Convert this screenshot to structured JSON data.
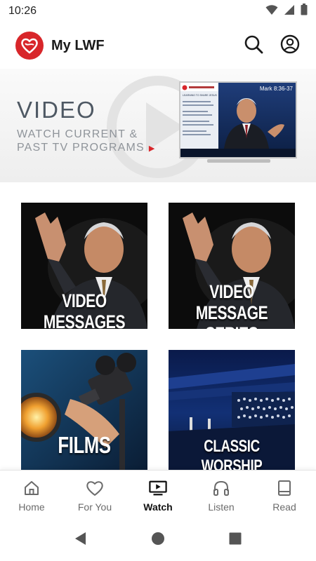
{
  "status_bar": {
    "time": "10:26"
  },
  "header": {
    "title": "My LWF",
    "logo_icon": "heart-logo-icon",
    "search_icon": "search-icon",
    "account_icon": "account-icon"
  },
  "banner": {
    "title": "VIDEO",
    "subtitle_line1": "WATCH CURRENT &",
    "subtitle_line2": "PAST TV PROGRAMS",
    "arrow": "▶",
    "tv_caption": "Mark 8:36-37",
    "tv_heading": "LEARNING TO SHARE JESUS"
  },
  "tiles": [
    {
      "label": "VIDEO MESSAGES"
    },
    {
      "label_line1": "VIDEO MESSAGE",
      "label_line2": "SERIES"
    },
    {
      "label": "FILMS"
    },
    {
      "label": "CLASSIC WORSHIP"
    }
  ],
  "nav": {
    "items": [
      {
        "label": "Home",
        "icon": "home-icon",
        "active": false
      },
      {
        "label": "For You",
        "icon": "heart-icon",
        "active": false
      },
      {
        "label": "Watch",
        "icon": "tv-icon",
        "active": true
      },
      {
        "label": "Listen",
        "icon": "headphones-icon",
        "active": false
      },
      {
        "label": "Read",
        "icon": "book-icon",
        "active": false
      }
    ]
  },
  "colors": {
    "brand_red": "#d8262a",
    "banner_title": "#4e5863",
    "banner_sub": "#8f949a",
    "nav_inactive": "#6b6b6b"
  }
}
